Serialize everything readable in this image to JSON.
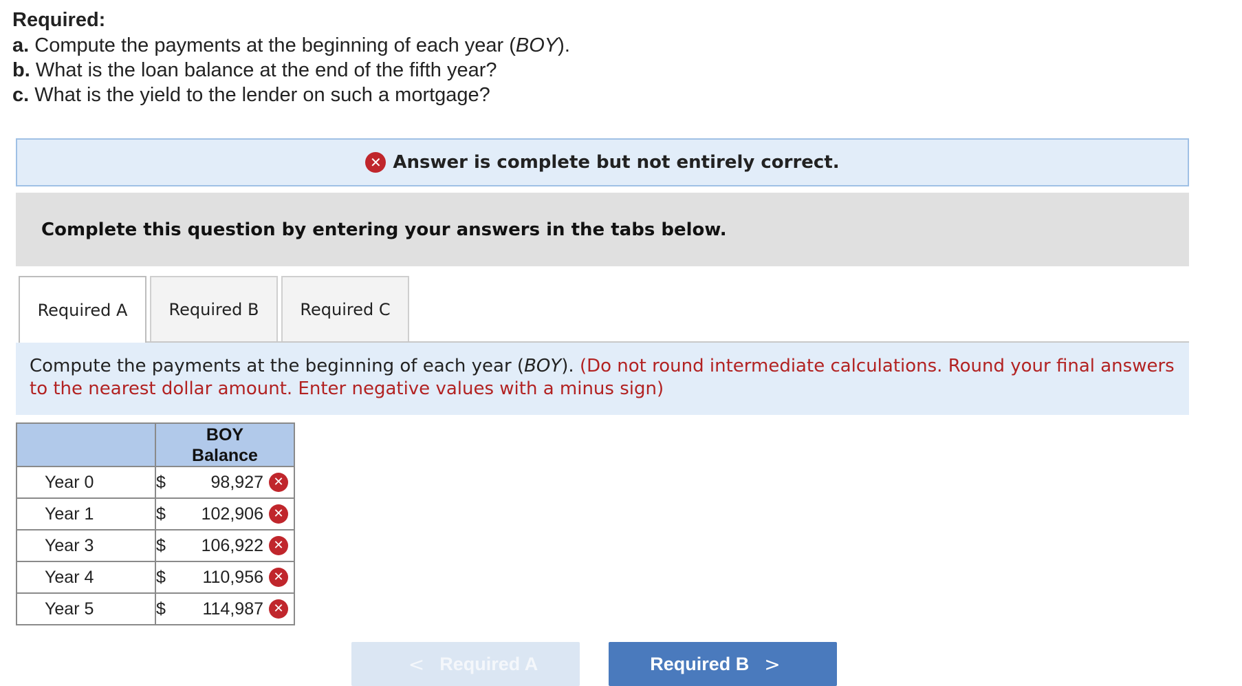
{
  "requirements": {
    "heading": "Required:",
    "items": [
      {
        "letter": "a.",
        "text": "Compute the payments at the beginning of each year (",
        "italic": "BOY",
        "tail": ")."
      },
      {
        "letter": "b.",
        "text": "What is the loan balance at the end of the fifth year?"
      },
      {
        "letter": "c.",
        "text": "What is the yield to the lender on such a mortgage?"
      }
    ]
  },
  "banner": {
    "text": "Answer is complete but not entirely correct.",
    "icon": "x-circle-icon",
    "icon_glyph": "✕",
    "status_color": "#c0262c"
  },
  "instruction": "Complete this question by entering your answers in the tabs below.",
  "tabs": [
    {
      "label": "Required A",
      "active": true
    },
    {
      "label": "Required B",
      "active": false
    },
    {
      "label": "Required C",
      "active": false
    }
  ],
  "prompt": {
    "lead": "Compute the payments at the beginning of each year (",
    "italic": "BOY",
    "close": "). ",
    "note": "(Do not round intermediate calculations. Round your final answers to the nearest dollar amount. Enter negative values with a minus sign)"
  },
  "table": {
    "header": {
      "col1": "",
      "col2_line1": "BOY",
      "col2_line2": "Balance"
    },
    "rows": [
      {
        "label": "Year 0",
        "currency": "$",
        "value": "98,927",
        "status": "incorrect"
      },
      {
        "label": "Year 1",
        "currency": "$",
        "value": "102,906",
        "status": "incorrect"
      },
      {
        "label": "Year 3",
        "currency": "$",
        "value": "106,922",
        "status": "incorrect"
      },
      {
        "label": "Year 4",
        "currency": "$",
        "value": "110,956",
        "status": "incorrect"
      },
      {
        "label": "Year 5",
        "currency": "$",
        "value": "114,987",
        "status": "incorrect"
      }
    ]
  },
  "navigation": {
    "prev_label": "Required A",
    "prev_chevron": "<",
    "next_label": "Required B",
    "next_chevron": ">"
  },
  "colors": {
    "header_fill": "#b1c9ea",
    "banner_fill": "#e2edf9",
    "next_button": "#4a7abd",
    "note_text": "#b22222"
  }
}
